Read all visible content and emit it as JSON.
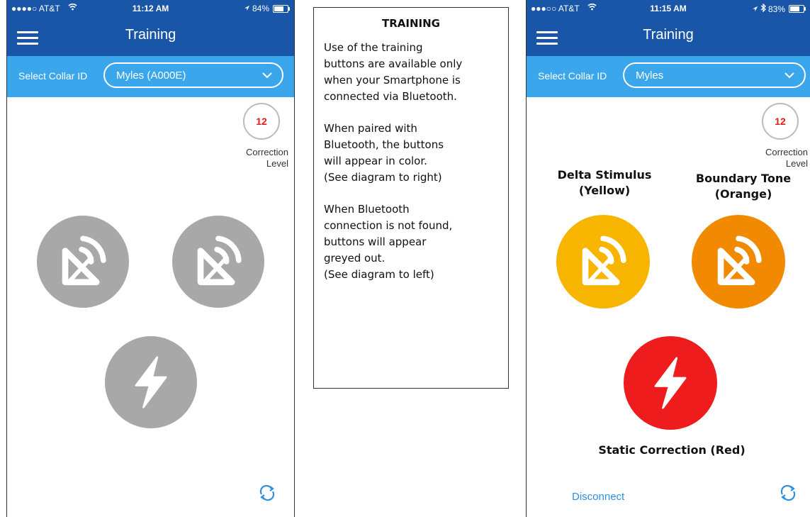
{
  "left_phone": {
    "status": {
      "carrier": "●●●●○ AT&T",
      "time": "11:12 AM",
      "battery": "84%",
      "battery_level": 0.84
    },
    "title": "Training",
    "select_label": "Select Collar ID",
    "collar_value": "Myles  (A000E)",
    "correction_level": "12",
    "correction_label_1": "Correction",
    "correction_label_2": "Level"
  },
  "info_panel": {
    "title": "TRAINING",
    "paragraph_1": "Use of the training\nbuttons are available only\nwhen your Smartphone is\nconnected via Bluetooth.",
    "paragraph_2": "When paired with\nBluetooth, the buttons\nwill appear in color.\n(See diagram to right)",
    "paragraph_3": "When Bluetooth\nconnection is not found,\nbuttons will appear\ngreyed out.\n(See diagram to left)"
  },
  "right_phone": {
    "status": {
      "carrier": "●●●○○ AT&T",
      "time": "11:15 AM",
      "battery": "83%",
      "battery_level": 0.83
    },
    "title": "Training",
    "select_label": "Select Collar ID",
    "collar_value": "Myles",
    "correction_level": "12",
    "correction_label_1": "Correction",
    "correction_label_2": "Level",
    "delta_caption_1": "Delta Stimulus",
    "delta_caption_2": "(Yellow)",
    "boundary_caption_1": "Boundary Tone",
    "boundary_caption_2": "(Orange)",
    "static_caption": "Static Correction (Red)",
    "disconnect": "Disconnect"
  },
  "colors": {
    "nav_blue": "#1a56a8",
    "select_bar": "#3aa7ec",
    "disabled_grey": "#a8a8a8",
    "yellow": "#f7b500",
    "orange": "#f28a00",
    "red": "#ee1c1c",
    "refresh_blue": "#2f8fde"
  },
  "icons": [
    "hamburger-icon",
    "chevron-down-icon",
    "signal-stimulus-icon",
    "lightning-bolt-icon",
    "refresh-icon",
    "wifi-icon",
    "location-arrow-icon",
    "bluetooth-icon",
    "battery-icon"
  ]
}
